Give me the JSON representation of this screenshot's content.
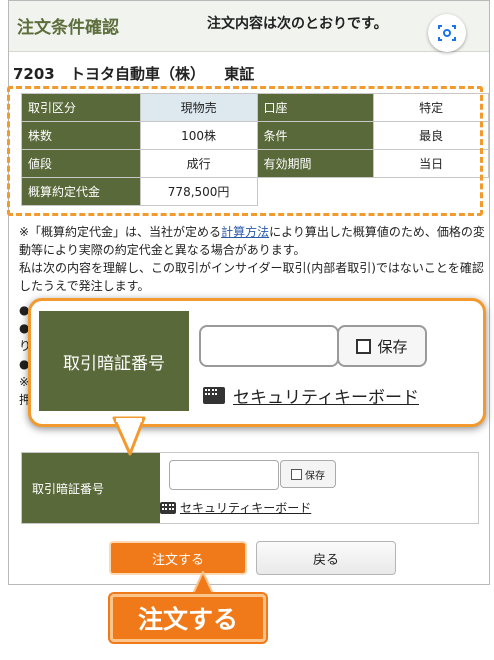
{
  "header": {
    "title": "注文条件確認",
    "message": "注文内容は次のとおりです。"
  },
  "stock": {
    "code": "7203",
    "name": "トヨタ自動車（株）",
    "market": "東証"
  },
  "order_table": {
    "rows": [
      {
        "label1": "取引区分",
        "value1": "現物売",
        "label2": "口座",
        "value2": "特定"
      },
      {
        "label1": "株数",
        "value1": "100株",
        "label2": "条件",
        "value2": "最良"
      },
      {
        "label1": "値段",
        "value1": "成行",
        "label2": "有効期間",
        "value2": "当日"
      },
      {
        "label1": "概算約定代金",
        "value1": "778,500円"
      }
    ]
  },
  "notes": {
    "n1_a": "※「概算約定代金」は、当社が定める",
    "n1_link": "計算方法",
    "n1_b": "により算出した概算値のため、価格の変動等により実際の約定代金と異なる場合があります。",
    "n2": "私は次の内容を理解し、この取引がインサイダー取引(内部者取引)ではないことを確認したうえで発注します。",
    "b1": "●",
    "b2": "●",
    "b3": "り",
    "b4": "●",
    "b5": "※",
    "b6": "押"
  },
  "security": {
    "label": "取引暗証番号",
    "input_value": "",
    "save_label": "保存",
    "keyboard_link": "セキュリティキーボード"
  },
  "zoom": {
    "label": "取引暗証番号",
    "save_label": "保存",
    "keyboard_link": "セキュリティキーボード"
  },
  "buttons": {
    "submit": "注文する",
    "back": "戻る"
  },
  "callout_label": "注文する",
  "colors": {
    "accent_green": "#59693a",
    "orange": "#f07a1a",
    "dash_orange": "#f29a2e"
  }
}
